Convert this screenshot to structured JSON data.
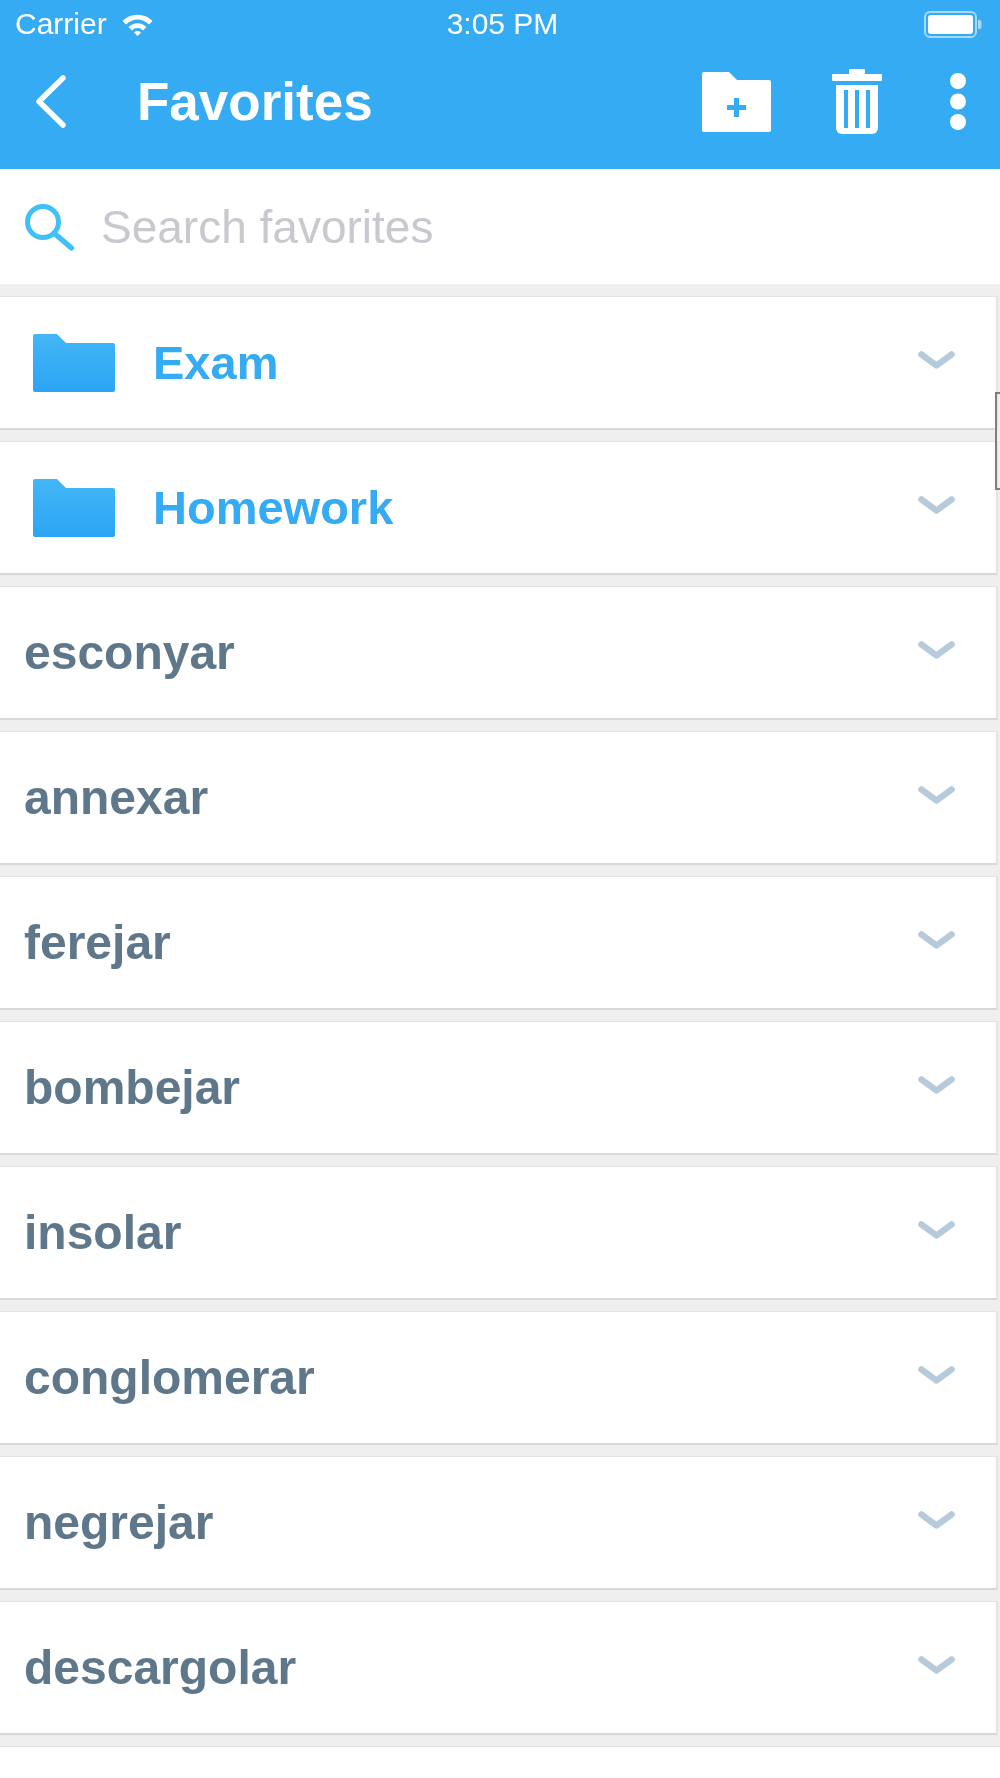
{
  "status_bar": {
    "carrier": "Carrier",
    "time": "3:05 PM"
  },
  "nav_bar": {
    "title": "Favorites"
  },
  "search": {
    "placeholder": "Search favorites"
  },
  "items": [
    {
      "kind": "folder",
      "label": "Exam"
    },
    {
      "kind": "folder",
      "label": "Homework"
    },
    {
      "kind": "word",
      "label": "esconyar"
    },
    {
      "kind": "word",
      "label": "annexar"
    },
    {
      "kind": "word",
      "label": "ferejar"
    },
    {
      "kind": "word",
      "label": "bombejar"
    },
    {
      "kind": "word",
      "label": "insolar"
    },
    {
      "kind": "word",
      "label": "conglomerar"
    },
    {
      "kind": "word",
      "label": "negrejar"
    },
    {
      "kind": "word",
      "label": "descargolar"
    }
  ]
}
